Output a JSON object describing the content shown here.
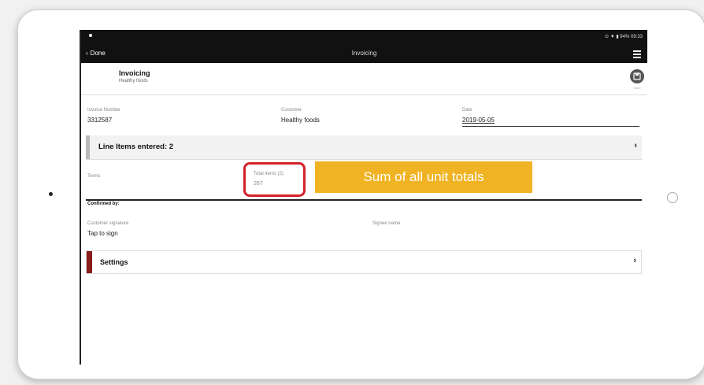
{
  "status_bar": {
    "indicators": "⊙ ▼ ▮ 94% 09:33"
  },
  "nav": {
    "back_label": "Done",
    "title": "Invoicing",
    "menu_icon": "hamburger-icon"
  },
  "header": {
    "title": "Invoicing",
    "subtitle": "Healthy foods",
    "save_caption": "Save",
    "save_icon": "save-icon"
  },
  "fields": {
    "invoice_number": {
      "label": "Invoice Number",
      "value": "3312587"
    },
    "customer": {
      "label": "Customer",
      "value": "Healthy foods"
    },
    "date": {
      "label": "Date",
      "value": "2019-05-05"
    }
  },
  "line_items": {
    "label": "Line Items entered: 2"
  },
  "totals": {
    "terms_label": "Terms",
    "total_label": "Total Items (2)",
    "total_value": "267"
  },
  "confirmation": {
    "section_label": "Confirmed by:",
    "signature_label": "Customer signature",
    "signature_value": "Tap to sign",
    "signer_label": "Signee name"
  },
  "settings": {
    "label": "Settings"
  },
  "annotation": {
    "callout": "Sum of all unit totals",
    "callout_color": "#f0b323",
    "highlight_color": "#d2232a"
  }
}
